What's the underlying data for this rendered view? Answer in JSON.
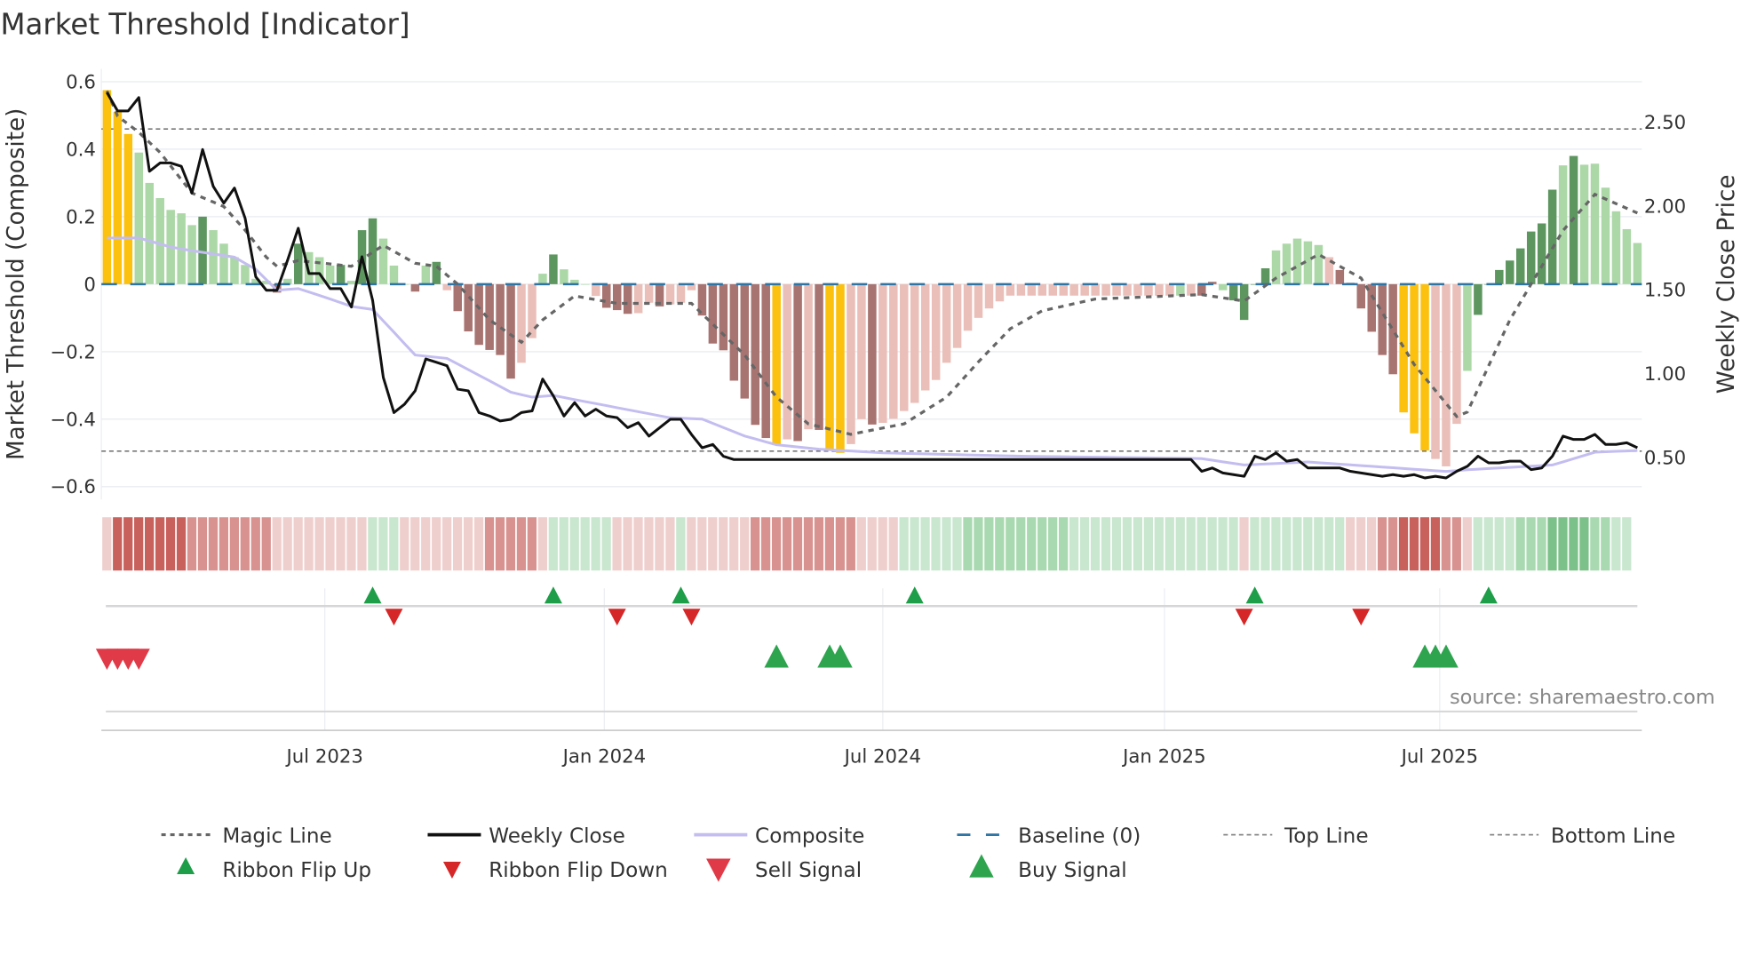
{
  "chart_data": {
    "type": "bar",
    "title": "Market Threshold [Indicator]",
    "ylabel": "Market Threshold (Composite)",
    "y2label": "Weekly Close Price",
    "ylim": [
      -0.66,
      0.62
    ],
    "y2lim": [
      0.3,
      2.75
    ],
    "yticks": [
      {
        "v": 0.6,
        "label": "0.6"
      },
      {
        "v": 0.4,
        "label": "0.4"
      },
      {
        "v": 0.2,
        "label": "0.2"
      },
      {
        "v": 0,
        "label": "0"
      },
      {
        "v": -0.2,
        "label": "−0.2"
      },
      {
        "v": -0.4,
        "label": "−0.4"
      },
      {
        "v": -0.6,
        "label": "−0.6"
      }
    ],
    "y2ticks": [
      {
        "v": 2.5,
        "label": "2.50"
      },
      {
        "v": 2.0,
        "label": "2.00"
      },
      {
        "v": 1.5,
        "label": "1.50"
      },
      {
        "v": 1.0,
        "label": "1.00"
      },
      {
        "v": 0.5,
        "label": "0.50"
      }
    ],
    "xticks": [
      {
        "i": 20.5,
        "label": "Jul 2023"
      },
      {
        "i": 46.8,
        "label": "Jan 2024"
      },
      {
        "i": 73,
        "label": "Jul 2024"
      },
      {
        "i": 99.5,
        "label": "Jan 2025"
      },
      {
        "i": 125.4,
        "label": "Jul 2025"
      }
    ],
    "grid": true,
    "top_line": 0.46,
    "bottom_line": -0.495,
    "baseline": 0,
    "bar_colors_key": {
      "Y": "#fbc10e",
      "DG": "#5e9660",
      "LG": "#acd8a7",
      "DR": "#a87471",
      "LR": "#eabfb9"
    },
    "composite_bars": [
      0.575,
      0.51,
      0.445,
      0.39,
      0.3,
      0.255,
      0.22,
      0.21,
      0.175,
      0.2,
      0.16,
      0.12,
      0.08,
      0.057,
      0.016,
      0.01,
      -0.025,
      0.016,
      0.12,
      0.095,
      0.08,
      0.055,
      0.057,
      0.01,
      0.16,
      0.195,
      0.135,
      0.055,
      0,
      -0.022,
      0.055,
      0.066,
      -0.018,
      -0.08,
      -0.14,
      -0.18,
      -0.195,
      -0.21,
      -0.28,
      -0.233,
      -0.16,
      0.031,
      0.088,
      0.044,
      0.013,
      0,
      -0.035,
      -0.07,
      -0.077,
      -0.088,
      -0.086,
      -0.055,
      -0.066,
      -0.06,
      -0.055,
      -0.018,
      -0.093,
      -0.176,
      -0.196,
      -0.286,
      -0.339,
      -0.417,
      -0.456,
      -0.477,
      -0.46,
      -0.465,
      -0.43,
      -0.432,
      -0.493,
      -0.5,
      -0.474,
      -0.4,
      -0.416,
      -0.411,
      -0.399,
      -0.376,
      -0.352,
      -0.315,
      -0.284,
      -0.233,
      -0.189,
      -0.138,
      -0.1,
      -0.072,
      -0.051,
      -0.034,
      -0.034,
      -0.034,
      -0.034,
      -0.034,
      -0.034,
      -0.034,
      -0.034,
      -0.034,
      -0.034,
      -0.034,
      -0.034,
      -0.034,
      -0.034,
      -0.034,
      -0.034,
      -0.034,
      -0.034,
      -0.034,
      0.007,
      -0.018,
      -0.048,
      -0.106,
      0,
      0.047,
      0.1,
      0.12,
      0.135,
      0.127,
      0.116,
      0.08,
      0.042,
      0.004,
      -0.072,
      -0.141,
      -0.21,
      -0.267,
      -0.38,
      -0.442,
      -0.493,
      -0.518,
      -0.54,
      -0.414,
      -0.257,
      -0.091,
      0,
      0.042,
      0.07,
      0.106,
      0.156,
      0.18,
      0.28,
      0.352,
      0.38,
      0.354,
      0.357,
      0.286,
      0.216,
      0.163,
      0.122
    ],
    "composite_bar_colors": "YYYLLLLLLDLLLLLLRLDLLLDLDDLLLRLDrRRRRRRrrLDLLLrRRRrrRrrrRRRRRRRYrRrRYYrrRrrrrrrrrrrrrrrrrrrrrrrrrrrrrLrRRLDDDDLLLLLrRRRRRRYYYrrrLDDDDDDDDLDLLLL",
    "weekly_close": [
      2.67,
      2.56,
      2.56,
      2.64,
      2.2,
      2.25,
      2.25,
      2.23,
      2.07,
      2.33,
      2.11,
      2.01,
      2.1,
      1.92,
      1.57,
      1.49,
      1.49,
      1.67,
      1.86,
      1.59,
      1.59,
      1.5,
      1.5,
      1.39,
      1.69,
      1.43,
      0.97,
      0.76,
      0.81,
      0.89,
      1.08,
      1.06,
      1.04,
      0.9,
      0.89,
      0.76,
      0.74,
      0.71,
      0.72,
      0.76,
      0.77,
      0.96,
      0.86,
      0.74,
      0.82,
      0.74,
      0.78,
      0.74,
      0.73,
      0.67,
      0.7,
      0.62,
      0.67,
      0.72,
      0.72,
      0.63,
      0.55,
      0.57,
      0.5,
      0.48,
      0.48,
      0.48,
      0.48,
      0.48,
      0.48,
      0.48,
      0.48,
      0.48,
      0.48,
      0.48,
      0.48,
      0.48,
      0.48,
      0.48,
      0.48,
      0.48,
      0.48,
      0.48,
      0.48,
      0.48,
      0.48,
      0.48,
      0.48,
      0.48,
      0.48,
      0.48,
      0.48,
      0.48,
      0.48,
      0.48,
      0.48,
      0.48,
      0.48,
      0.48,
      0.48,
      0.48,
      0.48,
      0.48,
      0.48,
      0.48,
      0.48,
      0.48,
      0.48,
      0.41,
      0.43,
      0.4,
      0.39,
      0.38,
      0.5,
      0.48,
      0.52,
      0.47,
      0.48,
      0.43,
      0.43,
      0.43,
      0.43,
      0.41,
      0.4,
      0.39,
      0.38,
      0.39,
      0.38,
      0.39,
      0.37,
      0.38,
      0.37,
      0.41,
      0.44,
      0.5,
      0.46,
      0.46,
      0.47,
      0.47,
      0.42,
      0.43,
      0.5,
      0.62,
      0.6,
      0.6,
      0.63,
      0.57,
      0.57,
      0.58,
      0.55
    ],
    "composite_line": [
      [
        0,
        0.137
      ],
      [
        3,
        0.137
      ],
      [
        6,
        0.11
      ],
      [
        8,
        0.099
      ],
      [
        12,
        0.08
      ],
      [
        14,
        0.044
      ],
      [
        16,
        -0.018
      ],
      [
        18,
        -0.013
      ],
      [
        21,
        -0.044
      ],
      [
        23,
        -0.066
      ],
      [
        25,
        -0.075
      ],
      [
        29,
        -0.21
      ],
      [
        32,
        -0.22
      ],
      [
        38,
        -0.32
      ],
      [
        40,
        -0.335
      ],
      [
        42,
        -0.33
      ],
      [
        48,
        -0.366
      ],
      [
        53,
        -0.396
      ],
      [
        56,
        -0.4
      ],
      [
        60,
        -0.45
      ],
      [
        63,
        -0.476
      ],
      [
        67,
        -0.489
      ],
      [
        73,
        -0.5
      ],
      [
        86,
        -0.51
      ],
      [
        103,
        -0.517
      ],
      [
        107,
        -0.536
      ],
      [
        113,
        -0.527
      ],
      [
        126,
        -0.555
      ],
      [
        128,
        -0.55
      ],
      [
        136,
        -0.536
      ],
      [
        140,
        -0.498
      ],
      [
        144,
        -0.493
      ]
    ],
    "magic_line": [
      [
        0,
        0.573
      ],
      [
        1,
        0.498
      ],
      [
        3,
        0.45
      ],
      [
        5,
        0.39
      ],
      [
        8,
        0.27
      ],
      [
        11,
        0.23
      ],
      [
        13,
        0.16
      ],
      [
        15,
        0.08
      ],
      [
        16,
        0.053
      ],
      [
        18,
        0.07
      ],
      [
        23,
        0.053
      ],
      [
        26,
        0.115
      ],
      [
        29,
        0.062
      ],
      [
        31,
        0.053
      ],
      [
        33,
        0
      ],
      [
        36,
        -0.106
      ],
      [
        39,
        -0.172
      ],
      [
        41,
        -0.106
      ],
      [
        44,
        -0.035
      ],
      [
        48,
        -0.057
      ],
      [
        55,
        -0.057
      ],
      [
        56,
        -0.088
      ],
      [
        60,
        -0.21
      ],
      [
        63,
        -0.335
      ],
      [
        66,
        -0.414
      ],
      [
        70,
        -0.445
      ],
      [
        75,
        -0.414
      ],
      [
        79,
        -0.335
      ],
      [
        82,
        -0.23
      ],
      [
        85,
        -0.132
      ],
      [
        88,
        -0.079
      ],
      [
        93,
        -0.044
      ],
      [
        103,
        -0.031
      ],
      [
        107,
        -0.05
      ],
      [
        110,
        0.018
      ],
      [
        114,
        0.088
      ],
      [
        118,
        0.018
      ],
      [
        123,
        -0.238
      ],
      [
        127,
        -0.392
      ],
      [
        128,
        -0.379
      ],
      [
        132,
        -0.106
      ],
      [
        134,
        0
      ],
      [
        137,
        0.159
      ],
      [
        140,
        0.266
      ],
      [
        144,
        0.211
      ]
    ],
    "ribbon_levels": [
      -1,
      -3,
      -3,
      -3,
      -3,
      -3,
      -3,
      -3,
      -2,
      -2,
      -2,
      -2,
      -2,
      -2,
      -2,
      -2,
      -1,
      -1,
      -1,
      -1,
      -1,
      -1,
      -1,
      -1,
      -1,
      1,
      1,
      1,
      -1,
      -1,
      -1,
      -1,
      -1,
      -1,
      -1,
      -1,
      -2,
      -2,
      -2,
      -2,
      -2,
      -1,
      1,
      1,
      1,
      1,
      1,
      1,
      -1,
      -1,
      -1,
      -1,
      -1,
      -1,
      1,
      -1,
      -1,
      -1,
      -1,
      -1,
      -1,
      -2,
      -2,
      -2,
      -2,
      -2,
      -2,
      -2,
      -2,
      -2,
      -2,
      -1,
      -1,
      -1,
      -1,
      1,
      1,
      1,
      1,
      1,
      1,
      2,
      2,
      2,
      2,
      2,
      2,
      2,
      2,
      2,
      2,
      1,
      1,
      1,
      1,
      1,
      1,
      1,
      1,
      1,
      1,
      1,
      1,
      1,
      1,
      1,
      1,
      -1,
      1,
      1,
      1,
      1,
      1,
      1,
      1,
      1,
      1,
      -1,
      -1,
      -1,
      -2,
      -2,
      -3,
      -3,
      -3,
      -3,
      -2,
      -2,
      -1,
      1,
      1,
      1,
      1,
      2,
      2,
      2,
      3,
      3,
      3,
      3,
      2,
      2,
      1,
      1
    ],
    "ribbon_flip_up": [
      25,
      42,
      54,
      76,
      108,
      130
    ],
    "ribbon_flip_down": [
      27,
      48,
      55,
      107,
      118
    ],
    "sell_signals": [
      0,
      1,
      2,
      3
    ],
    "buy_signals": [
      63,
      68,
      69,
      124,
      125,
      126
    ],
    "source": "source: sharemaestro.com",
    "legend": [
      {
        "label": "Magic Line",
        "symbol": "dotted",
        "color": "#666666"
      },
      {
        "label": "Weekly Close",
        "symbol": "solid",
        "color": "#111111"
      },
      {
        "label": "Composite",
        "symbol": "solid-light",
        "color": "#c3bdf0"
      },
      {
        "label": "Baseline (0)",
        "symbol": "dashed",
        "color": "#2e75a6"
      },
      {
        "label": "Top Line",
        "symbol": "fine-dash",
        "color": "#888888"
      },
      {
        "label": "Bottom Line",
        "symbol": "fine-dash",
        "color": "#888888"
      },
      {
        "label": "Ribbon Flip Up",
        "symbol": "tri-up-small",
        "color": "#1e9e48"
      },
      {
        "label": "Ribbon Flip Down",
        "symbol": "tri-down-small",
        "color": "#d62728"
      },
      {
        "label": "Sell Signal",
        "symbol": "tri-down",
        "color": "#e03a48"
      },
      {
        "label": "Buy Signal",
        "symbol": "tri-up",
        "color": "#2ea44f"
      }
    ]
  }
}
